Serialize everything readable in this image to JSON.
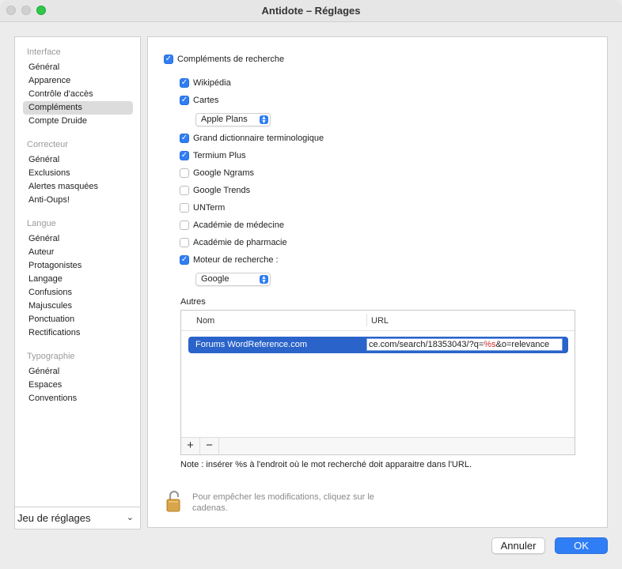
{
  "window": {
    "title": "Antidote – Réglages"
  },
  "sidebar": {
    "groups": [
      {
        "header": "Interface",
        "items": [
          "Général",
          "Apparence",
          "Contrôle d'accès",
          "Compléments",
          "Compte Druide"
        ]
      },
      {
        "header": "Correcteur",
        "items": [
          "Général",
          "Exclusions",
          "Alertes masquées",
          "Anti-Oups!"
        ]
      },
      {
        "header": "Langue",
        "items": [
          "Général",
          "Auteur",
          "Protagonistes",
          "Langage",
          "Confusions",
          "Majuscules",
          "Ponctuation",
          "Rectifications"
        ]
      },
      {
        "header": "Typographie",
        "items": [
          "Général",
          "Espaces",
          "Conventions"
        ]
      }
    ],
    "selected_item": "Compléments",
    "preset_label": "Jeu de réglages"
  },
  "panel": {
    "main_checkbox": {
      "label": "Compléments de recherche",
      "checked": true
    },
    "options": [
      {
        "label": "Wikipédia",
        "checked": true
      },
      {
        "label": "Cartes",
        "checked": true
      },
      {
        "label": "Grand dictionnaire terminologique",
        "checked": true
      },
      {
        "label": "Termium Plus",
        "checked": true
      },
      {
        "label": "Google Ngrams",
        "checked": false
      },
      {
        "label": "Google Trends",
        "checked": false
      },
      {
        "label": "UNTerm",
        "checked": false
      },
      {
        "label": "Académie de médecine",
        "checked": false
      },
      {
        "label": "Académie de pharmacie",
        "checked": false
      },
      {
        "label": "Moteur de recherche :",
        "checked": true
      }
    ],
    "maps_popup": "Apple Plans",
    "engine_popup": "Google",
    "autres_label": "Autres",
    "table": {
      "columns": [
        "Nom",
        "URL"
      ],
      "rows": [
        {
          "name": "Forums WordReference.com",
          "url_prefix": "ce.com/search/18353043/?q=",
          "url_token": "%s",
          "url_suffix": "&o=relevance"
        }
      ],
      "add_label": "+",
      "remove_label": "−"
    },
    "note": "Note : insérer %s à l'endroit où le mot recherché doit apparaitre dans l'URL.",
    "lock_text": "Pour empêcher les modifications, cliquez sur le cadenas."
  },
  "buttons": {
    "cancel": "Annuler",
    "ok": "OK"
  },
  "colors": {
    "accent": "#2f7ef6",
    "selection_row": "#2a63c9",
    "token_highlight": "#d32a2a"
  }
}
